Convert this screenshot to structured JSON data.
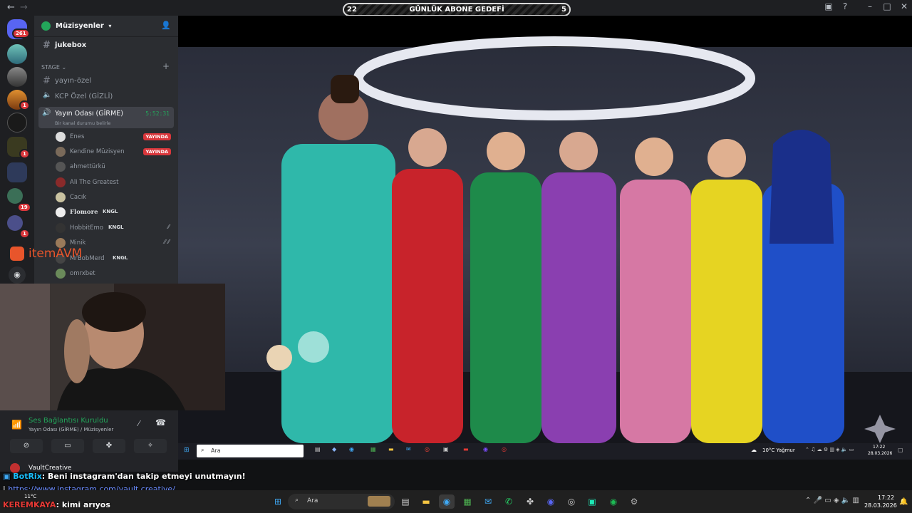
{
  "goal_bar": {
    "left": "22",
    "title": "GÜNLÜK ABONE GEDEFİ",
    "right": "5"
  },
  "servers": {
    "home_badge": "261",
    "badges": [
      "1",
      "1",
      "19",
      "1"
    ]
  },
  "server": {
    "name": "Müzisyenler"
  },
  "channels": {
    "jukebox": "jukebox",
    "stage_header": "STAGE",
    "yayin_ozel": "yayın-özel",
    "kcp": "KCP Özel (GİZLİ)",
    "voice_name": "Yayın Odası (GİRME)",
    "voice_timer": "5:52:31",
    "voice_status": "Bir kanal durumu belirle"
  },
  "members": [
    {
      "name": "Enes",
      "live": "YAYINDA"
    },
    {
      "name": "Kendine Müzisyen",
      "live": "YAYINDA"
    },
    {
      "name": "ahmettürkü"
    },
    {
      "name": "Ali The Greatest"
    },
    {
      "name": "Cacık"
    },
    {
      "name": "Flomore",
      "tag": "KNGL"
    },
    {
      "name": "HobbitEmo",
      "tag": "KNGL"
    },
    {
      "name": "Minik"
    },
    {
      "name": "MrBobMerd",
      "tag": "KNGL"
    },
    {
      "name": "omrxbet"
    }
  ],
  "sponsor": {
    "text": "itemAVM"
  },
  "voice_panel": {
    "title": "Ses Bağlantısı Kuruldu",
    "subtitle": "Yayın Odası (GİRME) / Müzisyenler",
    "user": "VaultCreative"
  },
  "inner_taskbar": {
    "search": "Ara",
    "weather": "10°C Yağmur",
    "time": "17:22",
    "date": "28.03.2026"
  },
  "chat": {
    "bot_name": "BotRix",
    "bot_msg": ": Beni instagram'dan takip etmeyi unutmayın!",
    "link": "https://www.instagram.com/vault.creative/",
    "user3": "KEREMKAYA",
    "msg3": ": kimi arıyos",
    "temp": "11°C"
  },
  "taskbar": {
    "search": "Ara",
    "time": "17:22",
    "date": "28.03.2026"
  },
  "colors": {
    "discord_bg": "#2b2d31",
    "live_red": "#da373c",
    "accent_green": "#23a55a"
  }
}
